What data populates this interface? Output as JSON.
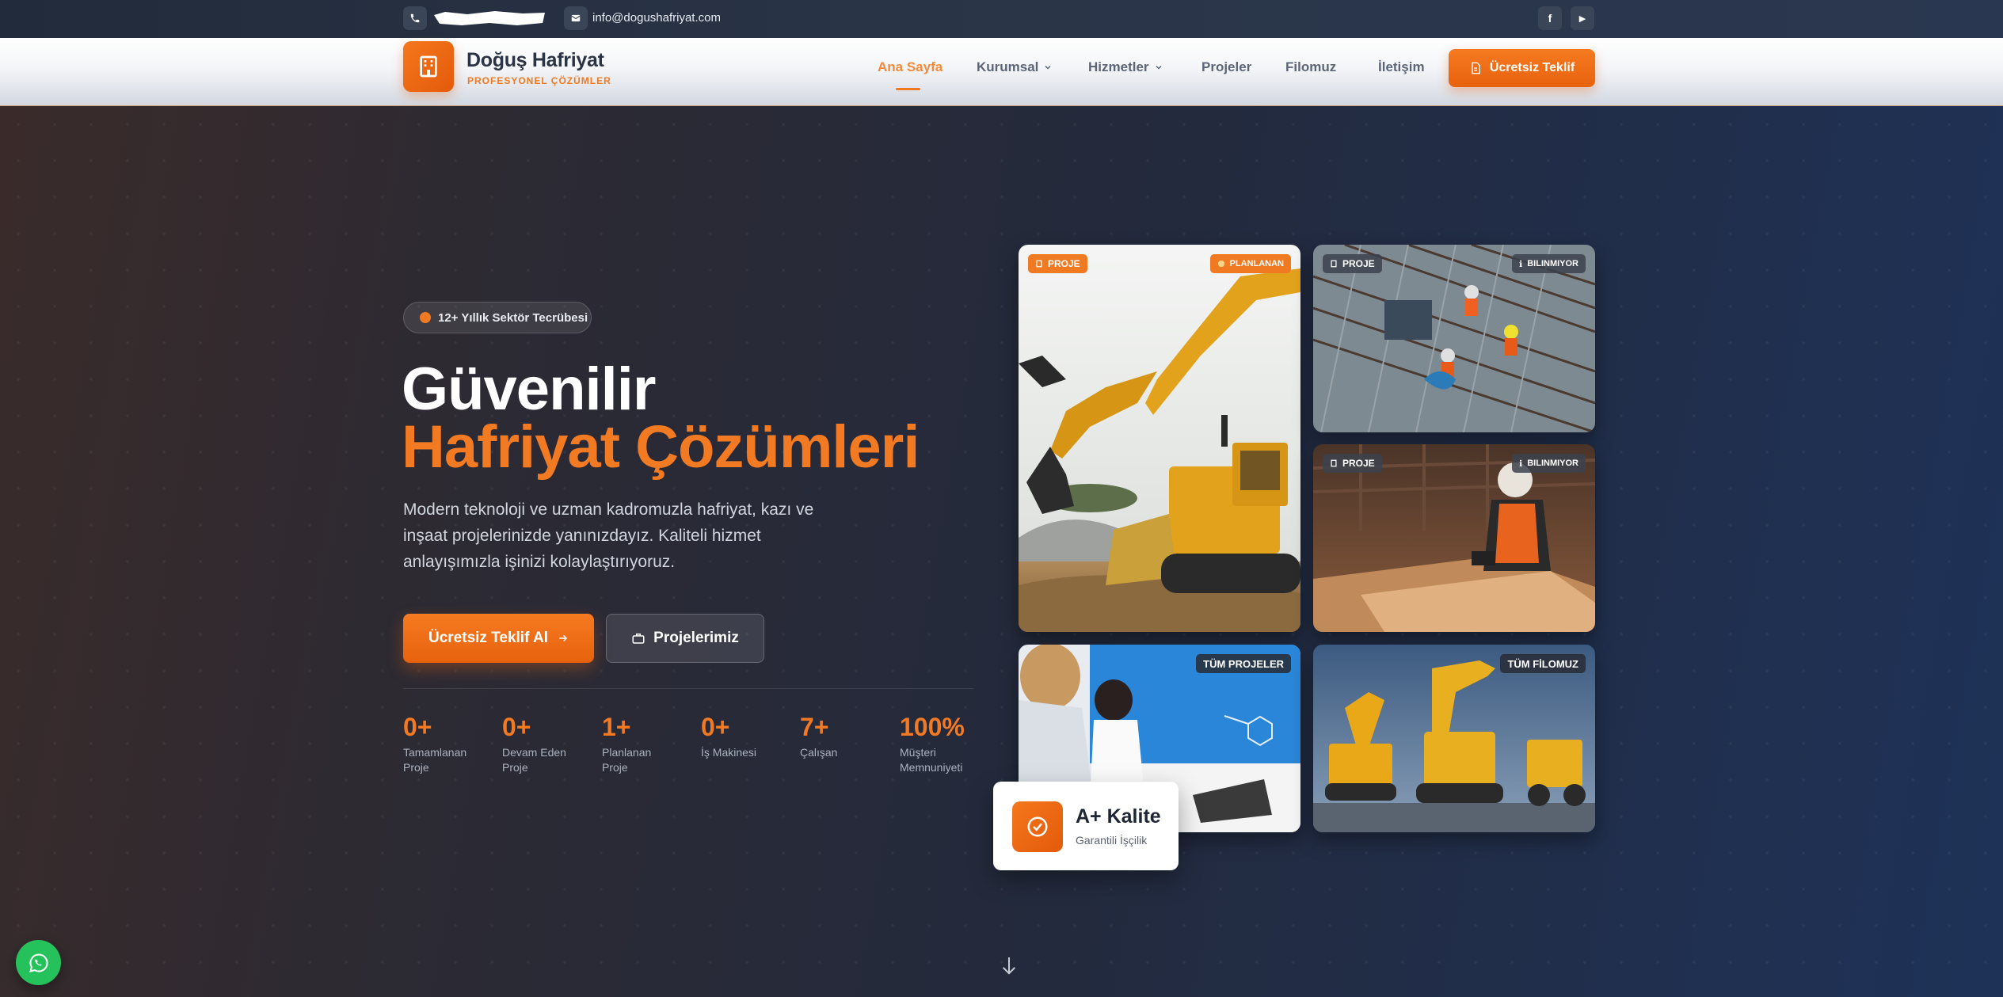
{
  "topbar": {
    "email": "info@dogushafriyat.com",
    "socials": [
      "f",
      "▶"
    ]
  },
  "header": {
    "brand_name": "Doğuş Hafriyat",
    "brand_sub": "PROFESYONEL ÇÖZÜMLER",
    "nav": [
      {
        "label": "Ana Sayfa",
        "active": true
      },
      {
        "label": "Kurumsal",
        "dropdown": true
      },
      {
        "label": "Hizmetler",
        "dropdown": true
      },
      {
        "label": "Projeler"
      },
      {
        "label": "Filomuz"
      },
      {
        "label": "İletişim"
      }
    ],
    "cta_label": "Ücretsiz Teklif"
  },
  "hero": {
    "badge": "12+ Yıllık Sektör Tecrübesi",
    "title_line1": "Güvenilir",
    "title_line2": "Hafriyat Çözümleri",
    "lead": "Modern teknoloji ve uzman kadromuzla hafriyat, kazı ve inşaat projelerinizde yanınızdayız. Kaliteli hizmet anlayışımızla işinizi kolaylaştırıyoruz.",
    "primary_button": "Ücretsiz Teklif Al",
    "secondary_button": "Projelerimiz",
    "stats": [
      {
        "num": "0+",
        "label": "Tamamlanan Proje"
      },
      {
        "num": "0+",
        "label": "Devam Eden Proje"
      },
      {
        "num": "1+",
        "label": "Planlanan Proje"
      },
      {
        "num": "0+",
        "label": "İş Makinesi"
      },
      {
        "num": "7+",
        "label": "Çalışan"
      },
      {
        "num": "100%",
        "label": "Müşteri Memnuniyeti"
      }
    ]
  },
  "gallery": {
    "card1": {
      "tag_left": "PROJE",
      "tag_right": "PLANLANAN"
    },
    "card2": {
      "tag_left": "PROJE",
      "tag_right": "BILINMIYOR"
    },
    "card3": {
      "tag_left": "PROJE",
      "tag_right": "BILINMIYOR"
    },
    "card4": {
      "tag": "TÜM PROJELER"
    },
    "card5": {
      "tag": "TÜM FİLOMUZ"
    }
  },
  "quality": {
    "title": "A+ Kalite",
    "subtitle": "Garantili İşçilik"
  },
  "colors": {
    "accent": "#f27a22",
    "whatsapp": "#25c25c"
  },
  "icons": {
    "phone": "phone-icon",
    "mail": "mail-icon",
    "logo": "building-icon",
    "cta": "document-icon",
    "arrow": "arrow-right-icon",
    "briefcase": "briefcase-icon",
    "check": "check-circle-icon",
    "whatsapp": "whatsapp-icon",
    "scroll": "arrow-down-icon"
  }
}
